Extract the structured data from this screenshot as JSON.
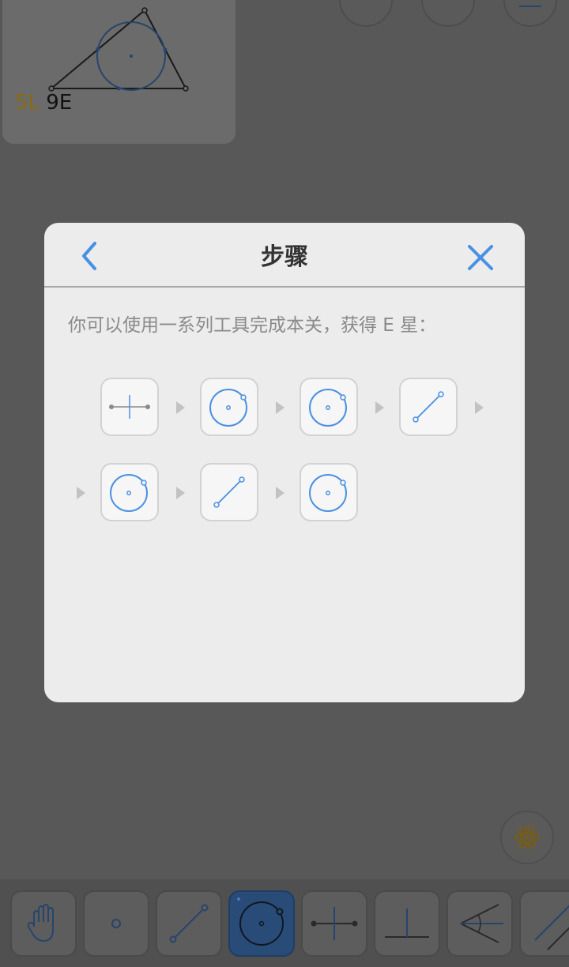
{
  "background": {
    "level_card": {
      "score_level": "5L",
      "score_energy": "9E"
    }
  },
  "dialog": {
    "title": "步骤",
    "description": "你可以使用一系列工具完成本关，获得 E 星：",
    "steps": [
      {
        "tool": "perpendicular-bisector"
      },
      {
        "tool": "circle"
      },
      {
        "tool": "circle"
      },
      {
        "tool": "line"
      },
      {
        "tool": "circle"
      },
      {
        "tool": "line"
      },
      {
        "tool": "circle"
      }
    ]
  },
  "toolbar": {
    "tools": [
      "hand",
      "point",
      "line",
      "circle",
      "perpendicular-bisector",
      "perpendicular",
      "angle-bisector",
      "parallel"
    ],
    "active": "circle"
  },
  "colors": {
    "accent": "#4a90e2",
    "overlay": "#585858",
    "dialog_bg": "#ececec",
    "score_level": "#8b6a10"
  }
}
